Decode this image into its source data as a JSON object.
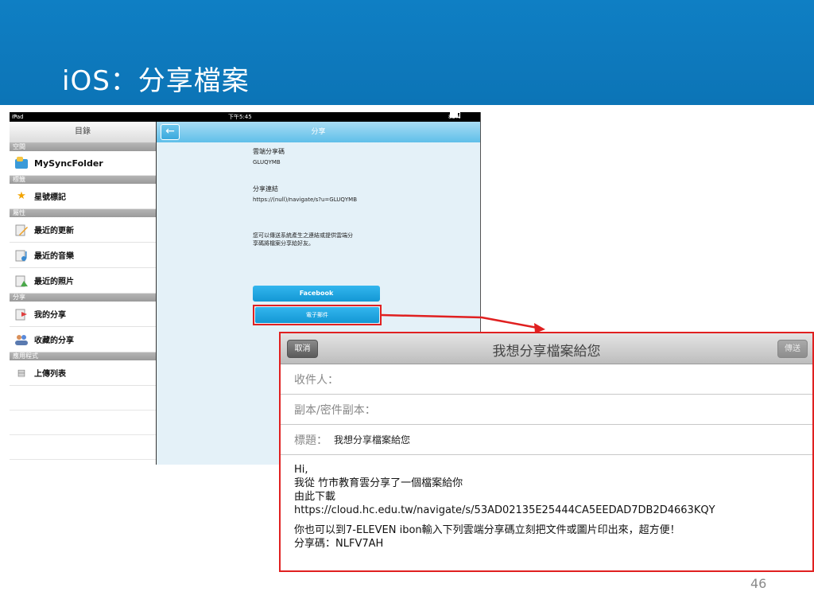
{
  "slide": {
    "title": "iOS：分享檔案",
    "page_number": "46",
    "colors": {
      "banner": "#0f7fc4",
      "highlight": "#e02020"
    }
  },
  "statusbar": {
    "device": "iPad",
    "time": "下午5:45",
    "battery": "83%"
  },
  "sidebar": {
    "header": "目錄",
    "sections": {
      "space": "空間",
      "tags": "標籤",
      "properties": "屬性",
      "share": "分享",
      "apps": "應用程式"
    },
    "items": {
      "mysyncfolder": "MySyncFolder",
      "starred": "星號標記",
      "recent_updates": "最近的更新",
      "recent_music": "最近的音樂",
      "recent_photos": "最近的照片",
      "my_shares": "我的分享",
      "saved_shares": "收藏的分享",
      "upload_list": "上傳列表"
    }
  },
  "detail": {
    "title": "分享",
    "cloud_code_label": "雲端分享碼",
    "cloud_code": "GLUQYMB",
    "share_link_label": "分享連結",
    "share_link": "https://(null)/navigate/s?u=GLUQYMB",
    "note_line1": "您可以傳送系統產生之連結或提供雲端分",
    "note_line2": "享碼將檔案分享給好友。",
    "facebook_button": "Facebook",
    "email_button": "電子郵件"
  },
  "mail": {
    "cancel": "取消",
    "send": "傳送",
    "subject_title": "我想分享檔案給您",
    "to_label": "收件人：",
    "cc_label": "副本/密件副本：",
    "subject_label": "標題：",
    "subject_value": "我想分享檔案給您",
    "body": {
      "line1": "Hi,",
      "line2": "我從 竹市教育雲分享了一個檔案給你",
      "line3": "由此下載",
      "line4": "https://cloud.hc.edu.tw/navigate/s/53AD02135E25444CA5EEDAD7DB2D4663KQY",
      "line5": "你也可以到7-ELEVEN ibon輸入下列雲端分享碼立刻把文件或圖片印出來，超方便！",
      "line6": "分享碼：NLFV7AH"
    }
  }
}
